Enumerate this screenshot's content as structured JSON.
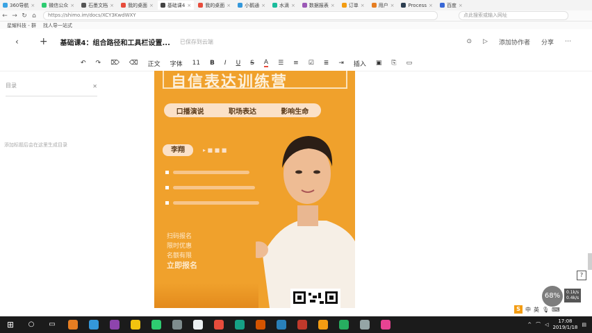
{
  "browser": {
    "tabs": [
      {
        "label": "360导航",
        "color": "#3aa3e3",
        "active": false
      },
      {
        "label": "微信公众",
        "color": "#2ecc71",
        "active": false
      },
      {
        "label": "石墨文档",
        "color": "#555555",
        "active": false
      },
      {
        "label": "我的桌面",
        "color": "#e74c3c",
        "active": false
      },
      {
        "label": "基础课4",
        "color": "#444444",
        "active": true
      },
      {
        "label": "我的桌面",
        "color": "#e74c3c",
        "active": false
      },
      {
        "label": "小鹅通",
        "color": "#3498db",
        "active": false
      },
      {
        "label": "水滴",
        "color": "#1abc9c",
        "active": false
      },
      {
        "label": "数据报表",
        "color": "#9b59b6",
        "active": false
      },
      {
        "label": "订单",
        "color": "#f39c12",
        "active": false
      },
      {
        "label": "用户",
        "color": "#e67e22",
        "active": false
      },
      {
        "label": "Process",
        "color": "#2c3e50",
        "active": false
      },
      {
        "label": "百度",
        "color": "#3867d6",
        "active": false
      }
    ],
    "url": "https://shimo.im/docs/XCY3KwdWXY",
    "search_placeholder": "点此搜索或输入网址",
    "bookmarks": [
      "星耀科技 - 群",
      "找人导一站式"
    ]
  },
  "doc": {
    "title": "基础课4：组合路径和工具栏设置...",
    "status": "已保存到云端",
    "actions": {
      "add_collab": "添加协作者",
      "share": "分享"
    }
  },
  "toolbar": {
    "undo": "↶",
    "redo": "↷",
    "format_paint": "⌦",
    "clear": "⌫",
    "style": "正文",
    "font": "字体",
    "size": "11",
    "bold": "B",
    "italic": "I",
    "underline": "U",
    "strike": "S",
    "color": "A",
    "list_ol": "☰",
    "list_ul": "≡",
    "check": "☑",
    "align": "≣",
    "indent": "⇥",
    "insert": "插入",
    "image": "▣",
    "link": "⎘",
    "comment": "▭"
  },
  "outline": {
    "title": "目录",
    "hint": "添加标题后会在这里生成目录"
  },
  "poster": {
    "heading": "自信表达训练营",
    "pills": [
      "口播演说",
      "职场表达",
      "影响生命"
    ],
    "teacher": "李翔",
    "info_lines": [
      "扫码报名",
      "限时优惠",
      "名额有限",
      "立即报名"
    ]
  },
  "speed": {
    "label": "68%",
    "up": "0.1k/s",
    "down": "0.4k/s"
  },
  "ime": {
    "lang": "中",
    "mode": "英"
  },
  "clock": {
    "time": "17:08",
    "date": "2019/1/18"
  },
  "colors": {
    "poster": "#f0a12c",
    "taskbar": "#1b1b1b"
  }
}
